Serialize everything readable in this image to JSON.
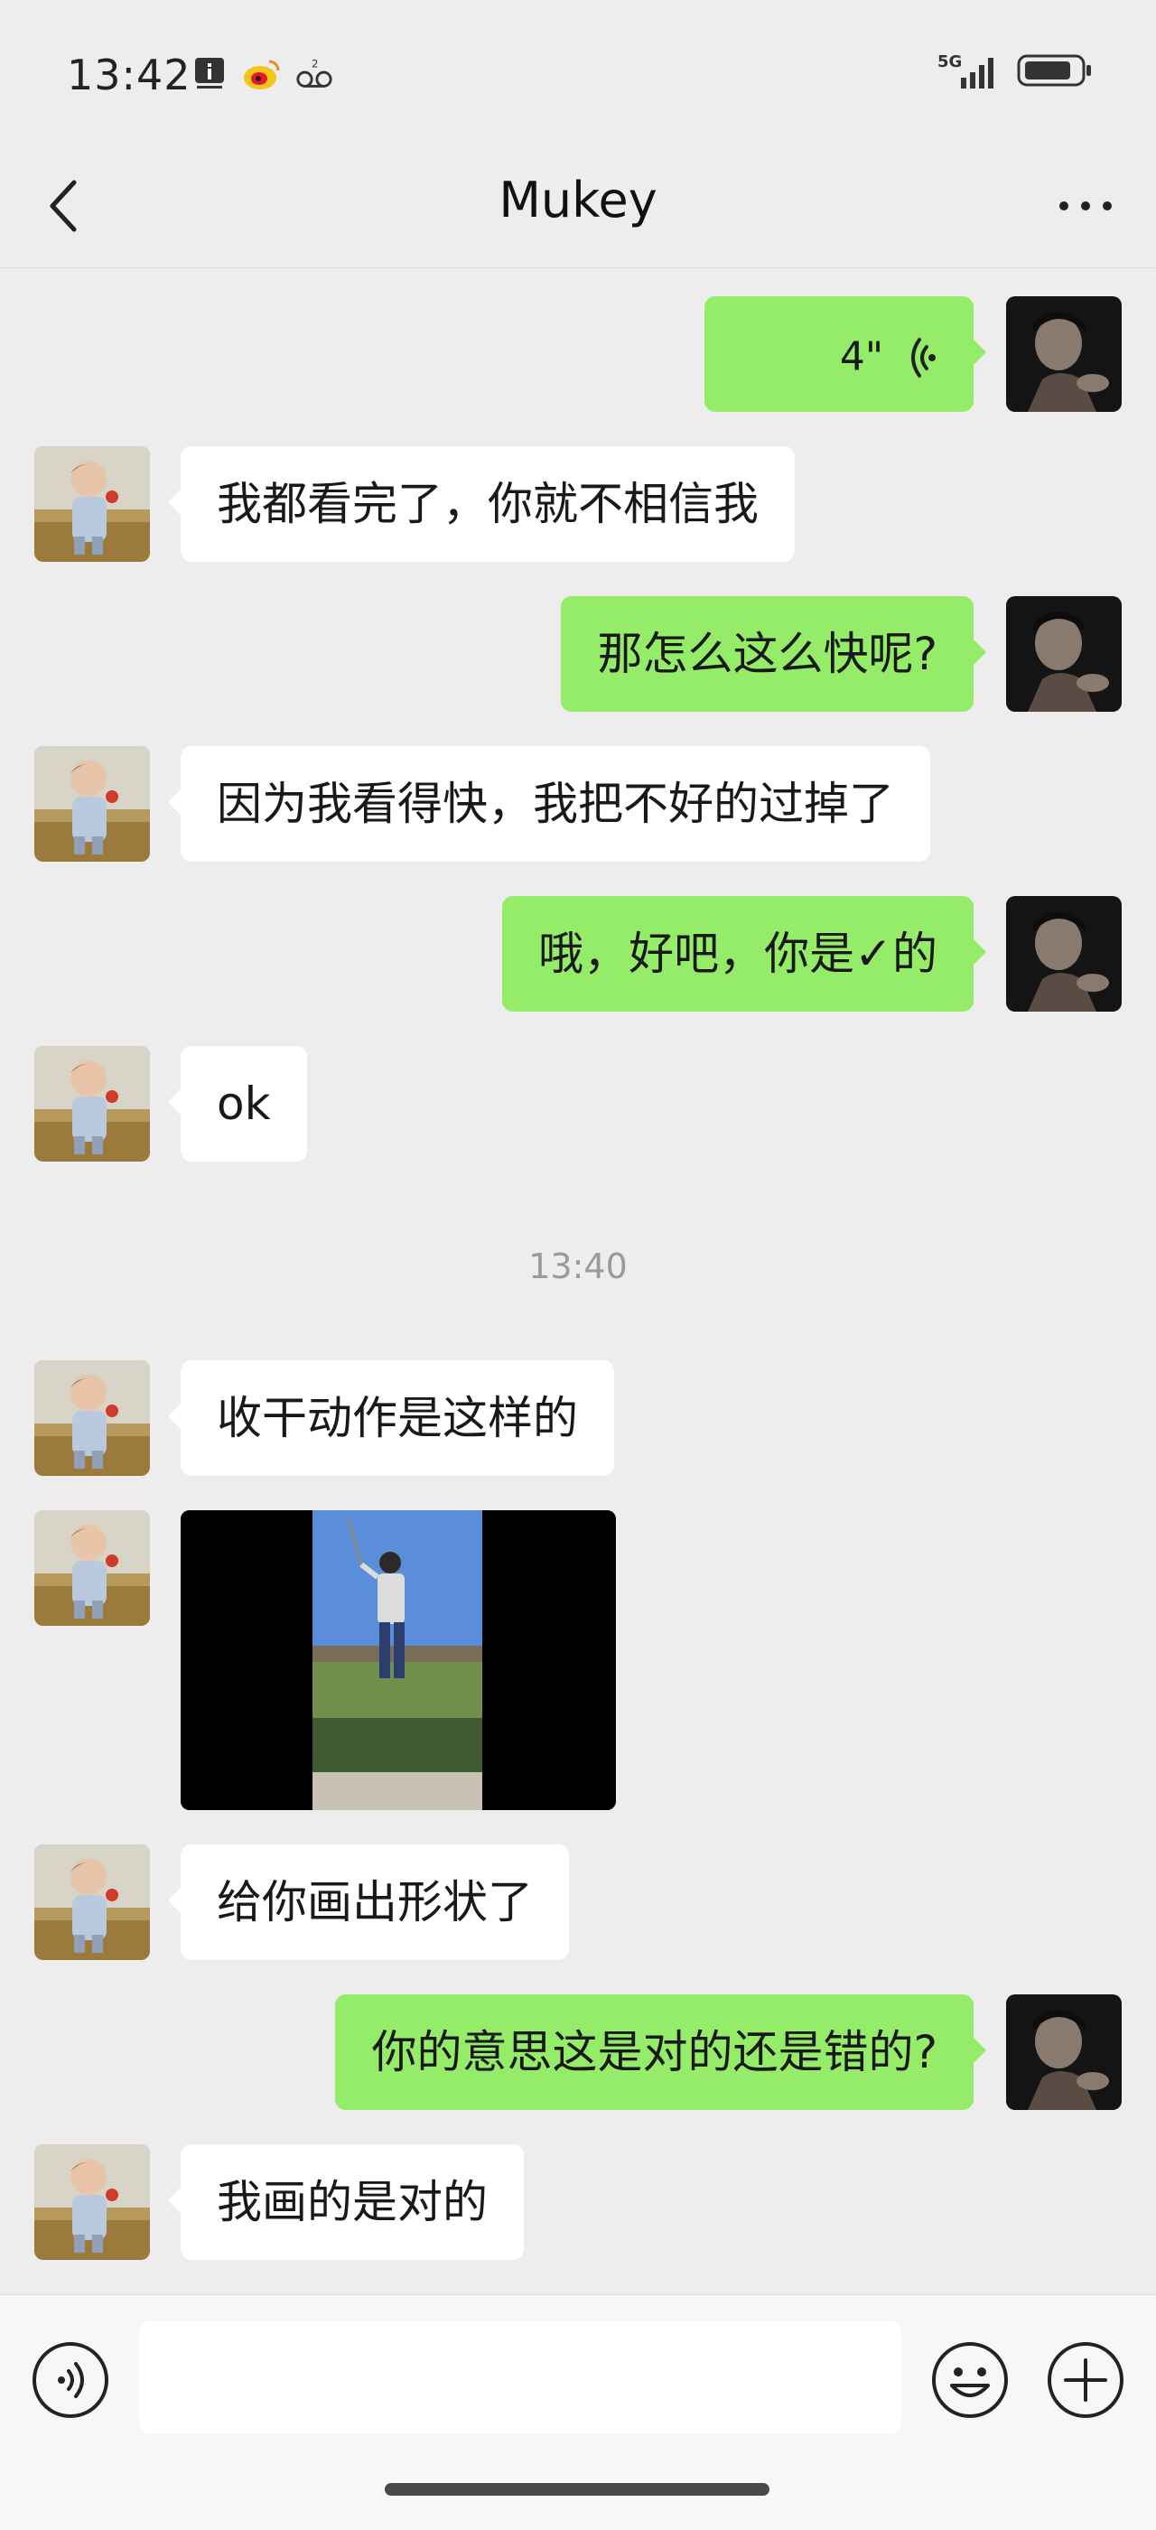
{
  "status_bar": {
    "time": "13:42",
    "network": "5G"
  },
  "header": {
    "title": "Mukey"
  },
  "messages": [
    {
      "side": "right",
      "type": "voice",
      "duration": "4\""
    },
    {
      "side": "left",
      "type": "text",
      "text": "我都看完了，你就不相信我"
    },
    {
      "side": "right",
      "type": "text",
      "text": "那怎么这么快呢?"
    },
    {
      "side": "left",
      "type": "text",
      "text": "因为我看得快，我把不好的过掉了"
    },
    {
      "side": "right",
      "type": "text",
      "text": "哦，好吧，你是✓的"
    },
    {
      "side": "left",
      "type": "text",
      "text": "ok"
    },
    {
      "side": "left",
      "type": "text",
      "text": "收干动作是这样的"
    },
    {
      "side": "left",
      "type": "video"
    },
    {
      "side": "left",
      "type": "text",
      "text": "给你画出形状了"
    },
    {
      "side": "right",
      "type": "text",
      "text": "你的意思这是对的还是错的?"
    },
    {
      "side": "left",
      "type": "text",
      "text": "我画的是对的"
    }
  ],
  "timestamp": "13:40",
  "input_bar": {
    "icons": [
      "voice-icon",
      "emoji-icon",
      "plus-icon"
    ]
  },
  "colors": {
    "background": "#ededed",
    "bubble_sent": "#95ec69",
    "bubble_received": "#ffffff"
  }
}
